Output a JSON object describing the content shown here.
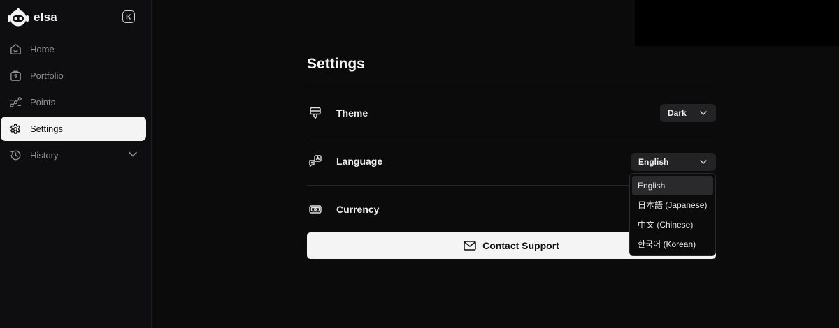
{
  "brand": {
    "name": "elsa"
  },
  "sidebar": {
    "items": [
      {
        "label": "Home",
        "icon": "home-icon",
        "active": false
      },
      {
        "label": "Portfolio",
        "icon": "portfolio-icon",
        "active": false
      },
      {
        "label": "Points",
        "icon": "points-icon",
        "active": false
      },
      {
        "label": "Settings",
        "icon": "gear-icon",
        "active": true
      },
      {
        "label": "History",
        "icon": "history-icon",
        "active": false,
        "expandable": true
      }
    ]
  },
  "settings": {
    "title": "Settings",
    "rows": [
      {
        "label": "Theme",
        "icon": "theme-icon",
        "value": "Dark"
      },
      {
        "label": "Language",
        "icon": "translate-icon",
        "value": "English"
      },
      {
        "label": "Currency",
        "icon": "currency-icon",
        "value": ""
      }
    ],
    "support_label": "Contact Support"
  },
  "language_dropdown": {
    "options": [
      "English",
      "日本語 (Japanese)",
      "中文 (Chinese)",
      "한국어 (Korean)"
    ],
    "selected": "English"
  },
  "colors": {
    "background": "#0b0b0c",
    "sidebar_active_bg": "#f4f4f4",
    "select_bg": "#232326",
    "button_bg": "#f4f4f4"
  }
}
